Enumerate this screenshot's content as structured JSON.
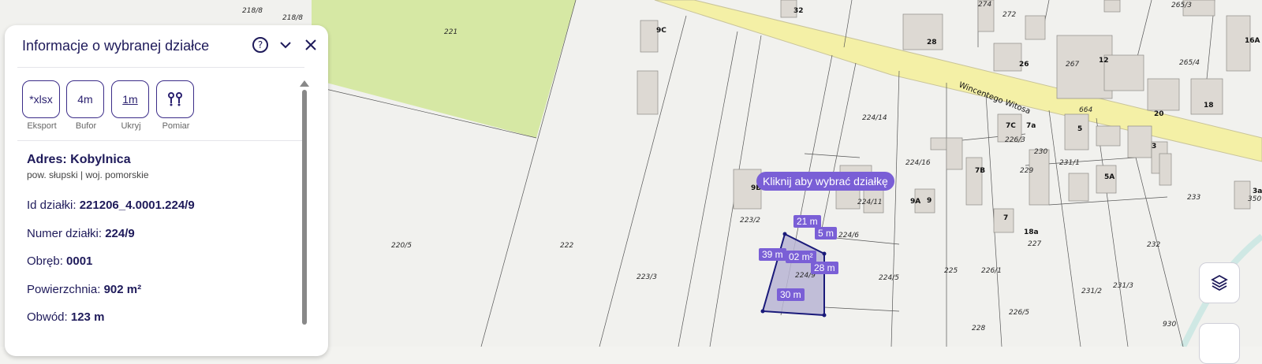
{
  "panel": {
    "title": "Informacje o wybranej działce",
    "tools": [
      {
        "icon": "*xlsx",
        "label": "Eksport"
      },
      {
        "icon": "4m",
        "label": "Bufor"
      },
      {
        "icon": "1m",
        "label": "Ukryj"
      },
      {
        "icon": "pin-pair-icon",
        "label": "Pomiar"
      }
    ],
    "address_label": "Adres:",
    "address_value": "Kobylnica",
    "region": "pow. słupski | woj. pomorskie",
    "id_label": "Id działki:",
    "id_value": "221206_4.0001.224/9",
    "number_label": "Numer działki:",
    "number_value": "224/9",
    "precinct_label": "Obręb:",
    "precinct_value": "0001",
    "area_label": "Powierzchnia:",
    "area_value": "902 m²",
    "perimeter_label": "Obwód:",
    "perimeter_value": "123 m"
  },
  "map": {
    "tooltip": "Kliknij aby wybrać działkę",
    "street": "Wincentego Witosa",
    "measurements": [
      "21 m",
      "5 m",
      "39 m",
      "02 m²",
      "28 m",
      "30 m"
    ],
    "parcels": [
      "218/8",
      "218/8",
      "221",
      "220/5",
      "222",
      "223/3",
      "223/2",
      "224/14",
      "224/16",
      "224/11",
      "224/6",
      "224/5",
      "224/9",
      "225",
      "226/1",
      "226/5",
      "228",
      "227",
      "229",
      "230",
      "226/3",
      "231/1",
      "231/2",
      "231/3",
      "232",
      "233",
      "265/3",
      "265/4",
      "267",
      "664",
      "274",
      "272",
      "930",
      "350"
    ],
    "houses": [
      "9C",
      "32",
      "28",
      "26",
      "12",
      "20",
      "18",
      "16A",
      "7C",
      "7a",
      "5",
      "3",
      "5A",
      "3a",
      "9B",
      "9A",
      "9",
      "7B",
      "7",
      "18a"
    ],
    "colors": {
      "selection": "#7a5fd6",
      "parcel_fill": "#b9b5d4",
      "vegetation": "#d6e8a4",
      "road": "#f4f0a6"
    }
  }
}
